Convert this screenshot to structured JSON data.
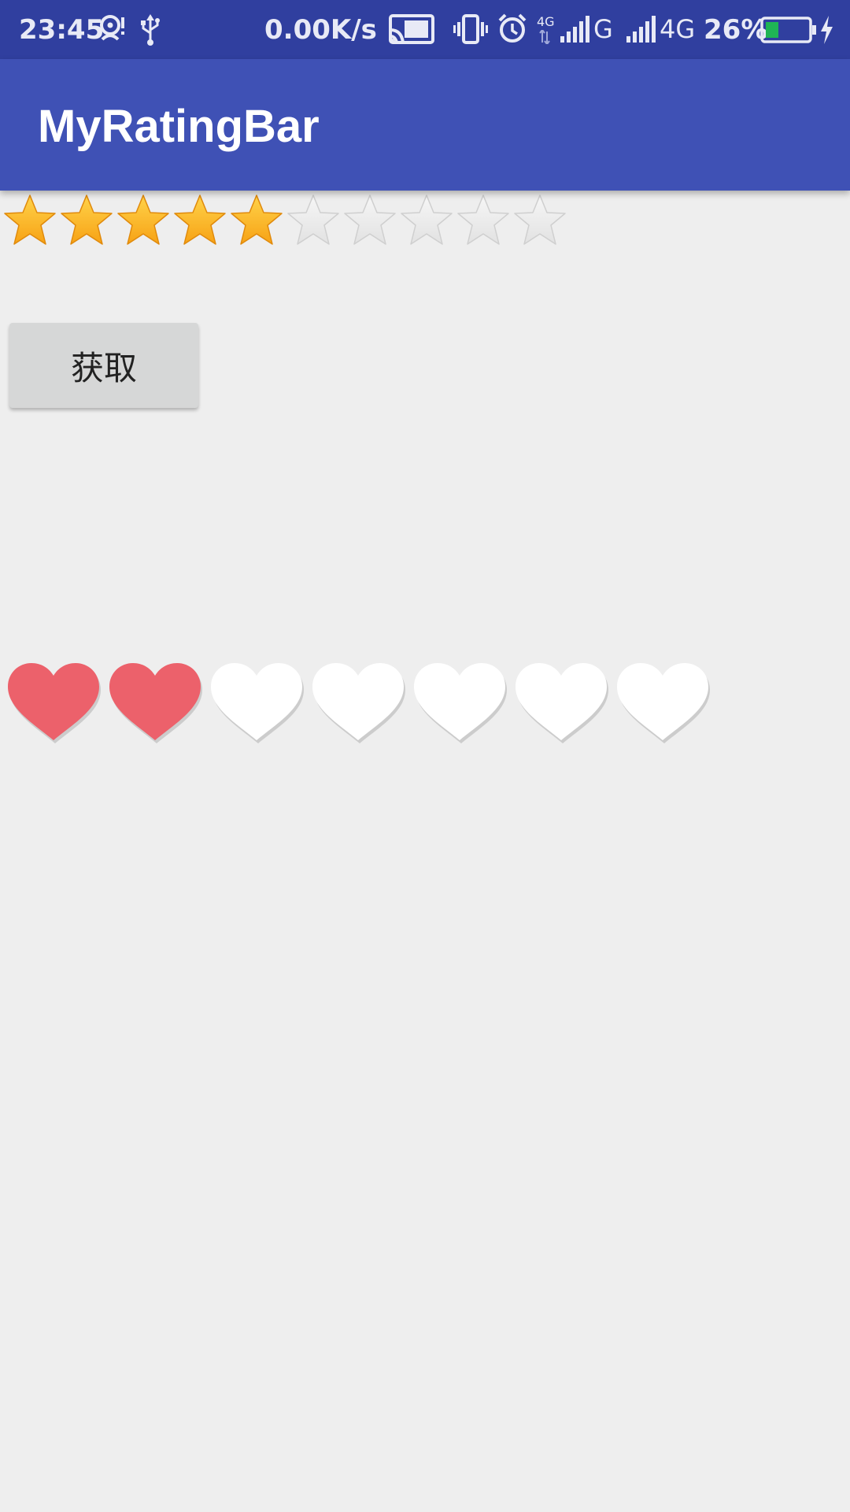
{
  "status_bar": {
    "time": "23:45",
    "net_speed": "0.00K/s",
    "network_small": "4G",
    "network_g": "G",
    "network_4g": "4G",
    "battery_percent": "26%",
    "icons": [
      "location-alert-icon",
      "usb-icon",
      "cast-icon",
      "vibrate-icon",
      "alarm-icon",
      "signal-icon",
      "signal-icon",
      "battery-icon",
      "charging-icon"
    ],
    "background_color": "#303f9f"
  },
  "app_bar": {
    "title": "MyRatingBar",
    "background_color": "#3f51b5"
  },
  "star_rating": {
    "rating": 5,
    "max": 10,
    "filled_color": "#f7a215",
    "empty_color": "#e2e2e2"
  },
  "get_button": {
    "label": "获取"
  },
  "heart_rating": {
    "rating": 2,
    "max": 7,
    "filled_color": "#ec616b",
    "empty_color": "#ffffff"
  }
}
